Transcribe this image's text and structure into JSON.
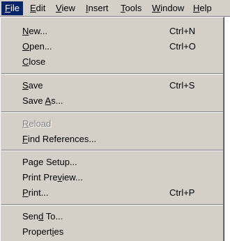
{
  "menubar": {
    "items": [
      {
        "pre": "",
        "acc": "F",
        "post": "ile"
      },
      {
        "pre": "",
        "acc": "E",
        "post": "dit"
      },
      {
        "pre": "",
        "acc": "V",
        "post": "iew"
      },
      {
        "pre": "",
        "acc": "I",
        "post": "nsert"
      },
      {
        "pre": "",
        "acc": "T",
        "post": "ools"
      },
      {
        "pre": "",
        "acc": "W",
        "post": "indow"
      },
      {
        "pre": "",
        "acc": "H",
        "post": "elp"
      }
    ]
  },
  "file_menu": {
    "items": [
      {
        "pre": "",
        "acc": "N",
        "post": "ew...",
        "shortcut": "Ctrl+N"
      },
      {
        "pre": "",
        "acc": "O",
        "post": "pen...",
        "shortcut": "Ctrl+O"
      },
      {
        "pre": "",
        "acc": "C",
        "post": "lose",
        "shortcut": ""
      },
      {
        "pre": "",
        "acc": "S",
        "post": "ave",
        "shortcut": "Ctrl+S"
      },
      {
        "pre": "Save ",
        "acc": "A",
        "post": "s...",
        "shortcut": ""
      },
      {
        "pre": "",
        "acc": "R",
        "post": "eload",
        "shortcut": "",
        "disabled": true
      },
      {
        "pre": "",
        "acc": "F",
        "post": "ind References...",
        "shortcut": ""
      },
      {
        "pre": "Pa",
        "acc": "g",
        "post": "e Setup...",
        "shortcut": ""
      },
      {
        "pre": "Print Pre",
        "acc": "v",
        "post": "iew...",
        "shortcut": ""
      },
      {
        "pre": "",
        "acc": "P",
        "post": "rint...",
        "shortcut": "Ctrl+P"
      },
      {
        "pre": "Sen",
        "acc": "d",
        "post": " To...",
        "shortcut": ""
      },
      {
        "pre": "Propert",
        "acc": "i",
        "post": "es",
        "shortcut": ""
      }
    ]
  },
  "colors": {
    "menu_face": "#d4d0c8",
    "highlight": "#0a246a",
    "disabled_text": "#808080"
  }
}
